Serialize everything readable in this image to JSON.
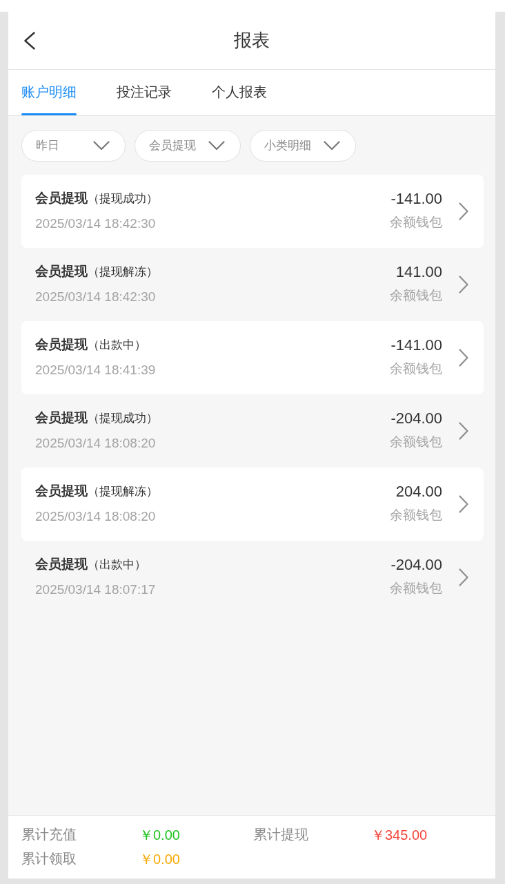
{
  "header": {
    "title": "报表"
  },
  "tabs": [
    {
      "label": "账户明细",
      "selected": true
    },
    {
      "label": "投注记录",
      "selected": false
    },
    {
      "label": "个人报表",
      "selected": false
    }
  ],
  "filters": [
    {
      "label": "昨日"
    },
    {
      "label": "会员提现"
    },
    {
      "label": "小类明细"
    }
  ],
  "transactions": [
    {
      "title": "**会员提现**（提现成功）",
      "time": "2025/03/14 18:42:30",
      "amount": "-141.00",
      "wallet": "余额钱包"
    },
    {
      "title": "**会员提现**（提现解冻）",
      "time": "2025/03/14 18:42:30",
      "amount": "141.00",
      "wallet": "余额钱包"
    },
    {
      "title": "**会员提现**（出款中）",
      "time": "2025/03/14 18:41:39",
      "amount": "-141.00",
      "wallet": "余额钱包"
    },
    {
      "title": "**会员提现**（提现成功）",
      "time": "2025/03/14 18:08:20",
      "amount": "-204.00",
      "wallet": "余额钱包"
    },
    {
      "title": "**会员提现**（提现解冻）",
      "time": "2025/03/14 18:08:20",
      "amount": "204.00",
      "wallet": "余额钱包"
    },
    {
      "title": "**会员提现**（出款中）",
      "time": "2025/03/14 18:07:17",
      "amount": "-204.00",
      "wallet": "余额钱包"
    }
  ],
  "summary": [
    {
      "label": "累计充值",
      "value": "￥0.00",
      "color": "#1fc31f"
    },
    {
      "label": "累计提现",
      "value": "￥345.00",
      "color": "#f5473f"
    },
    {
      "label": "累计领取",
      "value": "￥0.00",
      "color": "#f6a800"
    }
  ]
}
